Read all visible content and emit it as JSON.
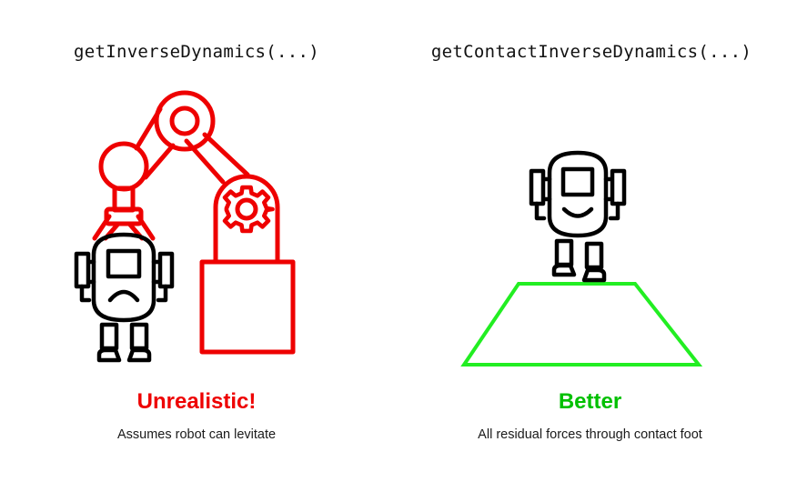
{
  "left": {
    "function_label": "getInverseDynamics(...)",
    "verdict": "Unrealistic!",
    "caption": "Assumes robot can levitate"
  },
  "right": {
    "function_label": "getContactInverseDynamics(...)",
    "verdict": "Better",
    "caption": "All residual forces through contact foot"
  },
  "colors": {
    "bad": "#ee0000",
    "good": "#00c000",
    "good_shape": "#22ee22",
    "ink": "#000000"
  },
  "icons": [
    "robot-arm-icon",
    "gear-icon",
    "sad-robot-icon",
    "happy-robot-icon",
    "ground-plane-icon"
  ]
}
